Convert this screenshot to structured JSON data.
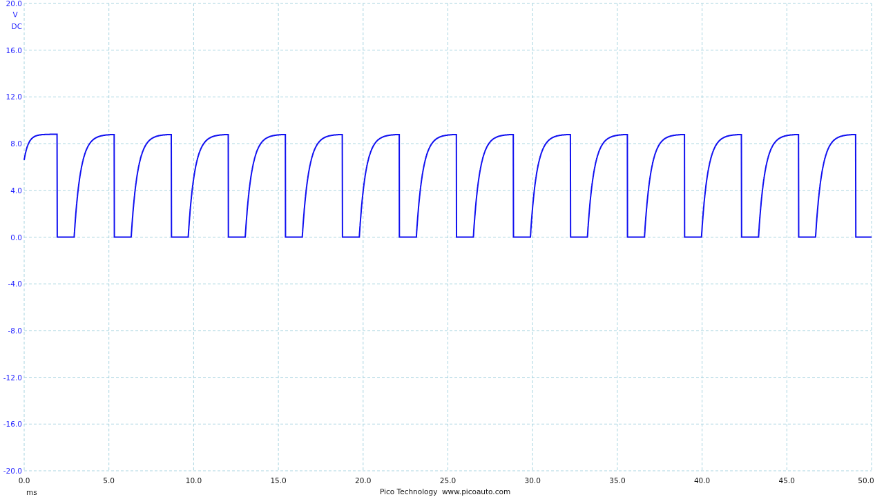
{
  "y_axis": {
    "unit": "V",
    "coupling": "DC",
    "ticks": [
      "20.0",
      "16.0",
      "12.0",
      "8.0",
      "4.0",
      "0.0",
      "-4.0",
      "-8.0",
      "-12.0",
      "-16.0",
      "-20.0"
    ]
  },
  "x_axis": {
    "unit": "ms",
    "ticks": [
      "0.0",
      "5.0",
      "10.0",
      "15.0",
      "20.0",
      "25.0",
      "30.0",
      "35.0",
      "40.0",
      "45.0",
      "50.0"
    ]
  },
  "footer": {
    "company": "Pico Technology",
    "website": "www.picoauto.com"
  }
}
